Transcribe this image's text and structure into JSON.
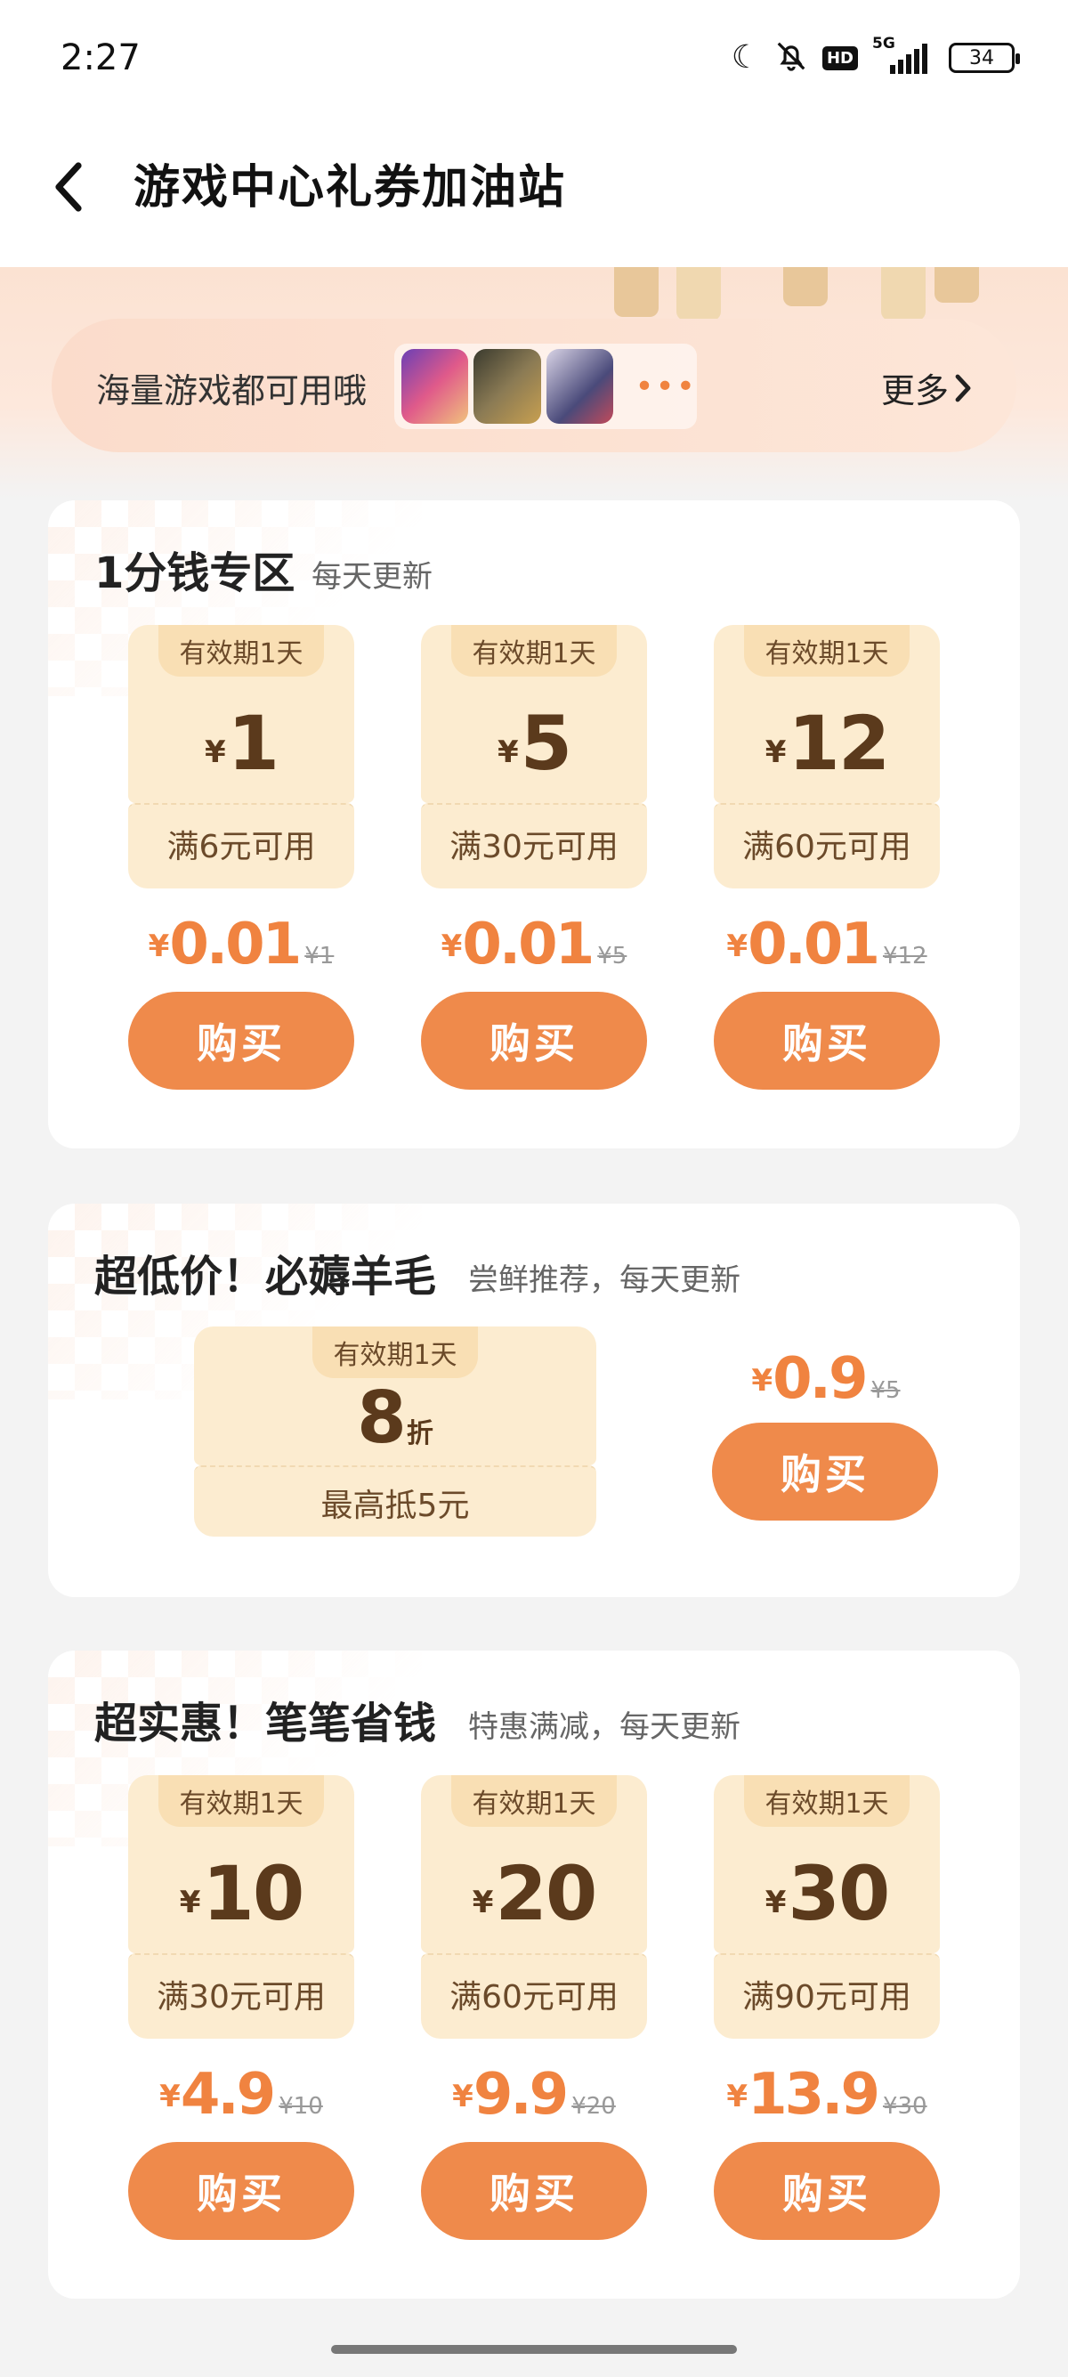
{
  "status_bar": {
    "time": "2:27",
    "network": "5G",
    "hd": "HD",
    "battery": "34"
  },
  "header": {
    "title": "游戏中心礼券加油站"
  },
  "games_banner": {
    "text": "海量游戏都可用哦",
    "more": "更多",
    "dots": "•••"
  },
  "section1": {
    "title": "1分钱专区",
    "subtitle": "每天更新",
    "coupons": [
      {
        "validity": "有效期1天",
        "yen": "¥",
        "amount": "1",
        "condition": "满6元可用",
        "price": "0.01",
        "original": "¥1",
        "buy": "购买"
      },
      {
        "validity": "有效期1天",
        "yen": "¥",
        "amount": "5",
        "condition": "满30元可用",
        "price": "0.01",
        "original": "¥5",
        "buy": "购买"
      },
      {
        "validity": "有效期1天",
        "yen": "¥",
        "amount": "12",
        "condition": "满60元可用",
        "price": "0.01",
        "original": "¥12",
        "buy": "购买"
      }
    ]
  },
  "section2": {
    "title": "超低价！必薅羊毛",
    "subtitle": "尝鲜推荐，每天更新",
    "coupon": {
      "validity": "有效期1天",
      "discount": "8",
      "discount_unit": "折",
      "condition": "最高抵5元",
      "yen": "¥",
      "price": "0.9",
      "original": "¥5",
      "buy": "购买"
    }
  },
  "section3": {
    "title": "超实惠！笔笔省钱",
    "subtitle": "特惠满减，每天更新",
    "coupons": [
      {
        "validity": "有效期1天",
        "yen": "¥",
        "amount": "10",
        "condition": "满30元可用",
        "price": "4.9",
        "original": "¥10",
        "buy": "购买"
      },
      {
        "validity": "有效期1天",
        "yen": "¥",
        "amount": "20",
        "condition": "满60元可用",
        "price": "9.9",
        "original": "¥20",
        "buy": "购买"
      },
      {
        "validity": "有效期1天",
        "yen": "¥",
        "amount": "30",
        "condition": "满90元可用",
        "price": "13.9",
        "original": "¥30",
        "buy": "购买"
      }
    ]
  },
  "colors": {
    "accent": "#ef8a4b",
    "coupon_bg": "#fcecd0",
    "coupon_text": "#5b3a1c"
  }
}
